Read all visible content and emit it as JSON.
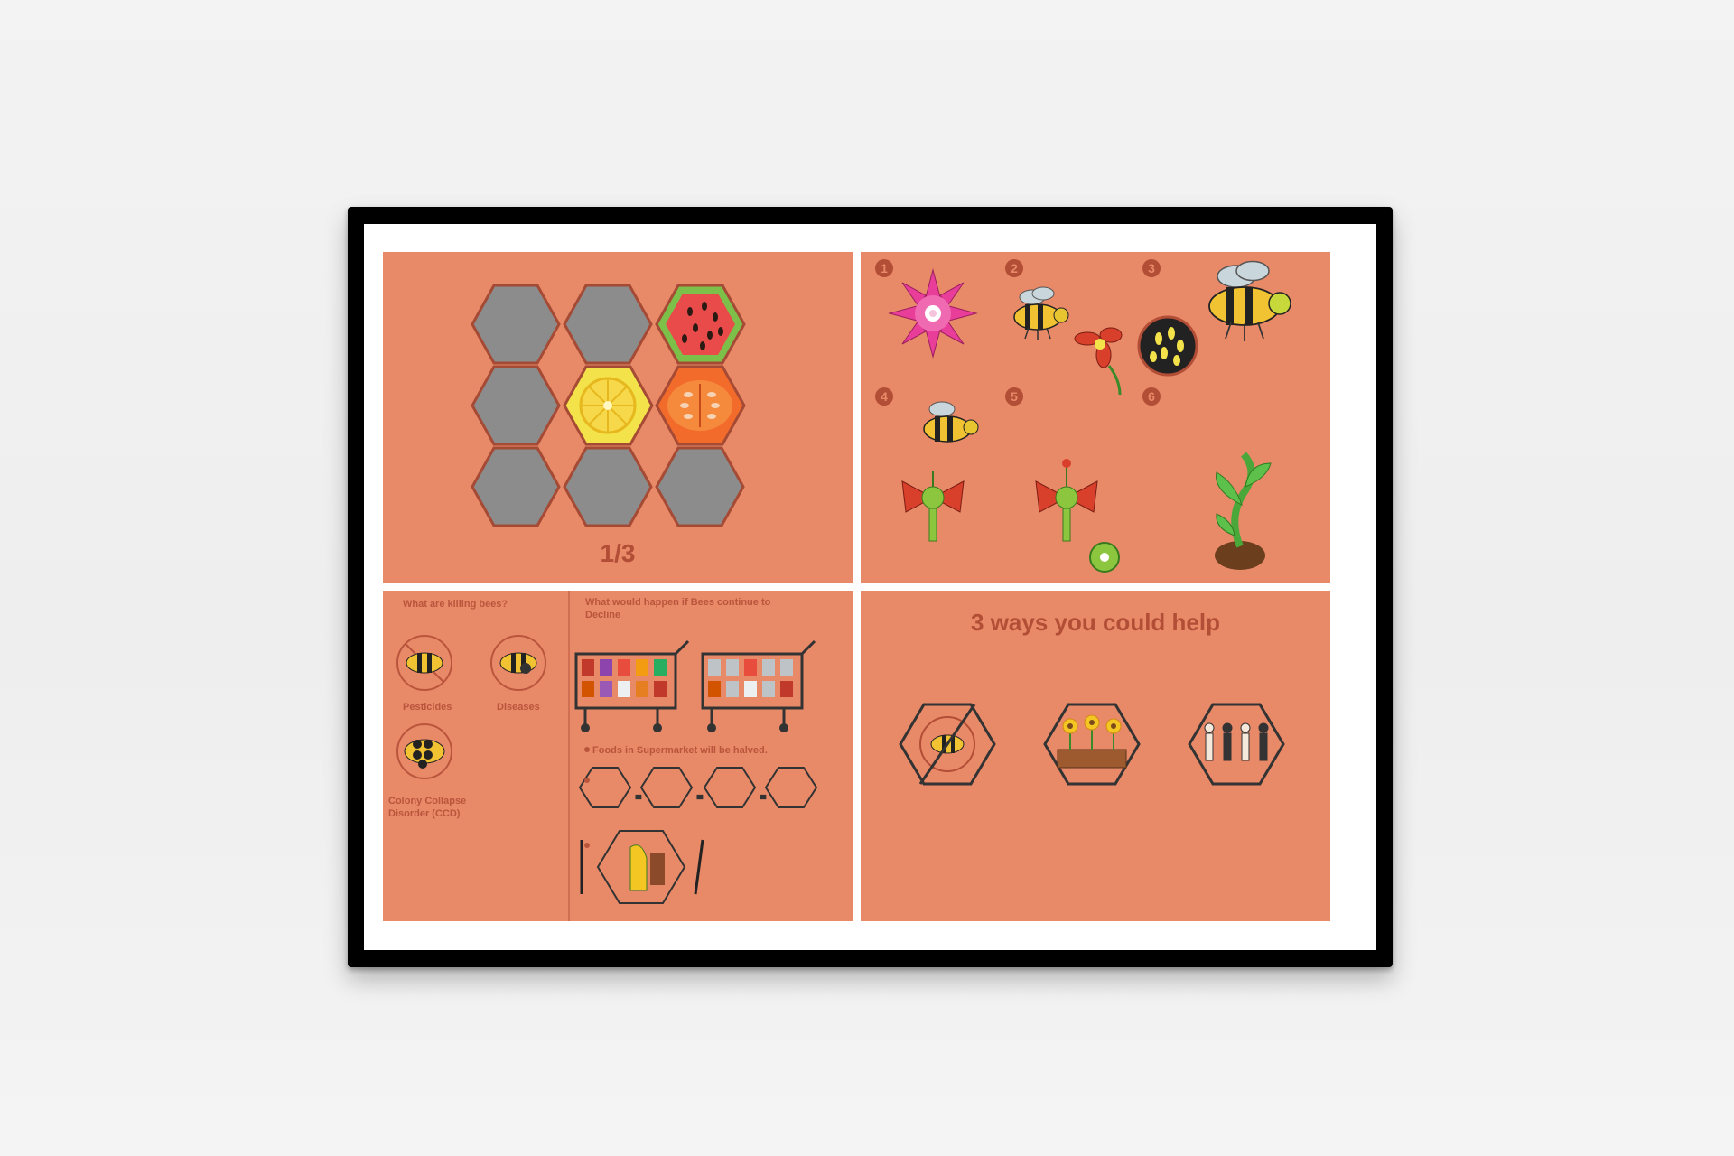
{
  "panel1": {
    "fraction": "1/3"
  },
  "panel2": {
    "steps": [
      "1",
      "2",
      "3",
      "4",
      "5",
      "6"
    ]
  },
  "panel3": {
    "killing_title": "What are killing bees?",
    "pesticides": "Pesticides",
    "diseases": "Diseases",
    "ccd": "Colony Collapse Disorder (CCD)",
    "decline_title": "What would happen if Bees continue to Decline",
    "supermarket_note": "Foods in Supermarket will be halved."
  },
  "panel4": {
    "title": "3 ways you could help"
  },
  "colors": {
    "panel": "#e88968",
    "accent": "#b24d36",
    "hex_gray": "#8c8c8c",
    "frame": "#000000"
  },
  "icons": [
    "watermelon-icon",
    "lemon-icon",
    "papaya-icon",
    "flower-icon",
    "bee-icon",
    "seedling-icon",
    "shopping-cart-icon",
    "no-pesticide-icon",
    "garden-icon",
    "people-icon"
  ]
}
